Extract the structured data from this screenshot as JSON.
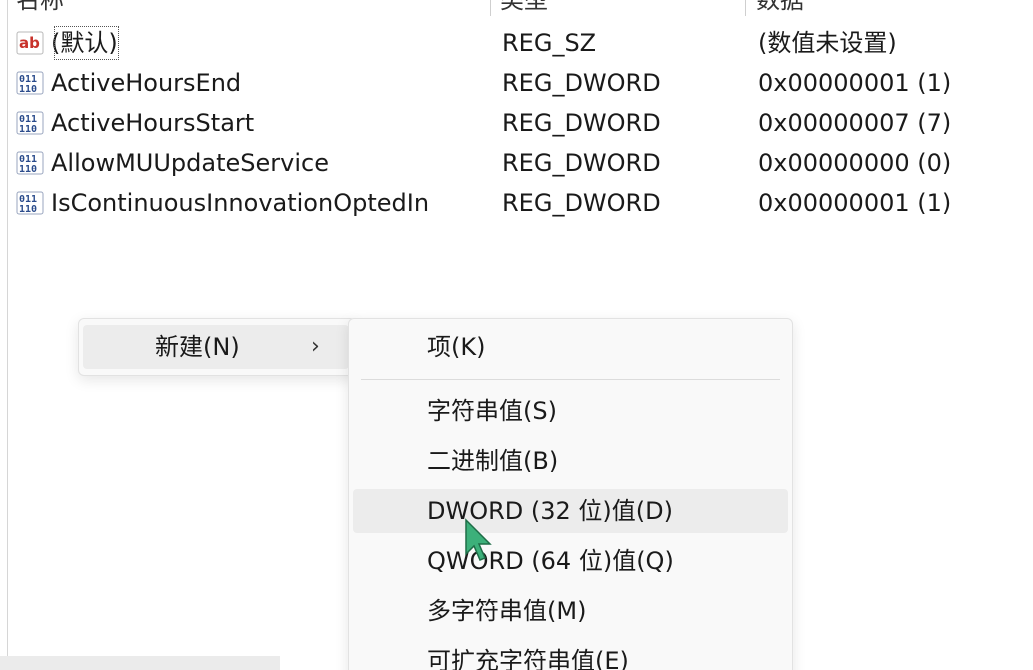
{
  "columns": {
    "name": "名称",
    "type": "类型",
    "data": "数据"
  },
  "rows": [
    {
      "icon": "string-value-icon",
      "name": "(默认)",
      "type": "REG_SZ",
      "value": "(数值未设置)"
    },
    {
      "icon": "binary-value-icon",
      "name": "ActiveHoursEnd",
      "type": "REG_DWORD",
      "value": "0x00000001 (1)"
    },
    {
      "icon": "binary-value-icon",
      "name": "ActiveHoursStart",
      "type": "REG_DWORD",
      "value": "0x00000007 (7)"
    },
    {
      "icon": "binary-value-icon",
      "name": "AllowMUUpdateService",
      "type": "REG_DWORD",
      "value": "0x00000000 (0)"
    },
    {
      "icon": "binary-value-icon",
      "name": "IsContinuousInnovationOptedIn",
      "type": "REG_DWORD",
      "value": "0x00000001 (1)"
    }
  ],
  "context_menu": {
    "new_label": "新建(N)",
    "chevron": "›"
  },
  "submenu": {
    "items": [
      {
        "label": "项(K)"
      },
      {
        "label": "字符串值(S)"
      },
      {
        "label": "二进制值(B)"
      },
      {
        "label": "DWORD (32 位)值(D)"
      },
      {
        "label": "QWORD (64 位)值(Q)"
      },
      {
        "label": "多字符串值(M)"
      },
      {
        "label": "可扩充字符串值(E)"
      }
    ]
  },
  "colors": {
    "string_icon_red": "#c8322b",
    "binary_icon_blue": "#2b4c8c",
    "menu_bg": "#f9f9f9",
    "hover_bg": "#ececec",
    "cursor_green": "#3cb07a"
  }
}
